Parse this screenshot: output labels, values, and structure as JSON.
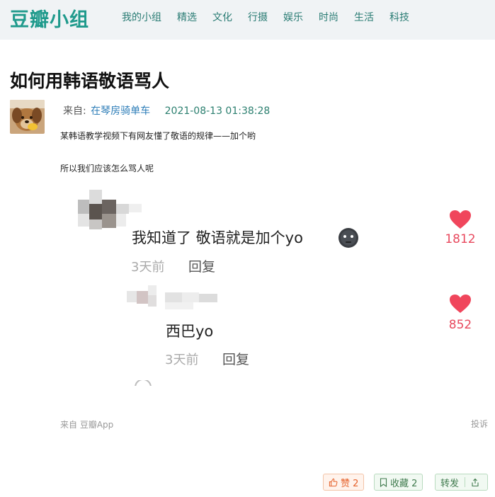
{
  "header": {
    "logo": "豆瓣小组",
    "nav": [
      "我的小组",
      "精选",
      "文化",
      "行摄",
      "娱乐",
      "时尚",
      "生活",
      "科技"
    ]
  },
  "post": {
    "title": "如何用韩语敬语骂人",
    "from_label": "来自:",
    "author": "在琴房骑单车",
    "time": "2021-08-13 01:38:28",
    "paragraphs": [
      "某韩语教学视频下有网友懂了敬语的规律——加个哟",
      "所以我们应该怎么骂人呢"
    ]
  },
  "screenshot": {
    "comments": [
      {
        "text": "我知道了 敬语就是加个yo",
        "time": "3天前",
        "reply": "回复",
        "likes": "1812"
      },
      {
        "text": "西巴yo",
        "time": "3天前",
        "reply": "回复",
        "likes": "852"
      }
    ]
  },
  "footer": {
    "source": "来自 豆瓣App",
    "report": "投诉",
    "like": "赞 2",
    "favorite": "收藏 2",
    "share": "转发"
  },
  "colors": {
    "brand": "#1f9a8c",
    "heart": "#f0465c"
  }
}
